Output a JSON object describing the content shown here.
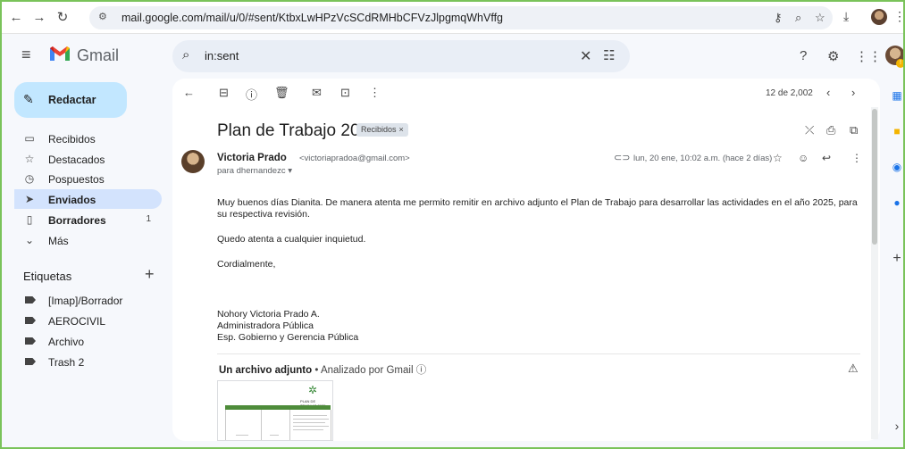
{
  "browser": {
    "url": "mail.google.com/mail/u/0/#sent/KtbxLwHPzVcSCdRMHbCFVzJlpgmqWhVffg"
  },
  "app": {
    "name": "Gmail"
  },
  "search": {
    "query": "in:sent"
  },
  "sidebar": {
    "compose_label": "Redactar",
    "items": [
      {
        "label": "Recibidos",
        "count": ""
      },
      {
        "label": "Destacados",
        "count": ""
      },
      {
        "label": "Pospuestos",
        "count": ""
      },
      {
        "label": "Enviados",
        "count": ""
      },
      {
        "label": "Borradores",
        "count": "1"
      },
      {
        "label": "Más",
        "count": ""
      }
    ],
    "labels_title": "Etiquetas",
    "labels": [
      "[Imap]/Borrador",
      "AEROCIVIL",
      "Archivo",
      "Trash 2"
    ]
  },
  "toolbar": {
    "pager": "12 de 2,002"
  },
  "email": {
    "subject": "Plan de Trabajo 2025",
    "label_chip": "Recibidos",
    "sender_name": "Victoria Prado",
    "sender_email": "<victoriapradoa@gmail.com>",
    "recipient": "para dhernandezc",
    "date": "lun, 20 ene, 10:02 a.m. (hace 2 días)",
    "body": [
      "Muy buenos días Dianita. De manera atenta me permito remitir en archivo adjunto el Plan de Trabajo para desarrollar las actividades en el año 2025, para su respectiva revisión.",
      "Quedo atenta a cualquier inquietud.",
      "Cordialmente,"
    ],
    "signature": [
      "Nohory Victoria Prado A.",
      "Administradora Pública",
      "Esp. Gobierno y Gerencia Pública"
    ],
    "attachment_title": "Un archivo adjunto",
    "attachment_scan": "Analizado por Gmail"
  },
  "attachment_preview": {
    "title": "PLAN DE TRABAJO 2025"
  }
}
